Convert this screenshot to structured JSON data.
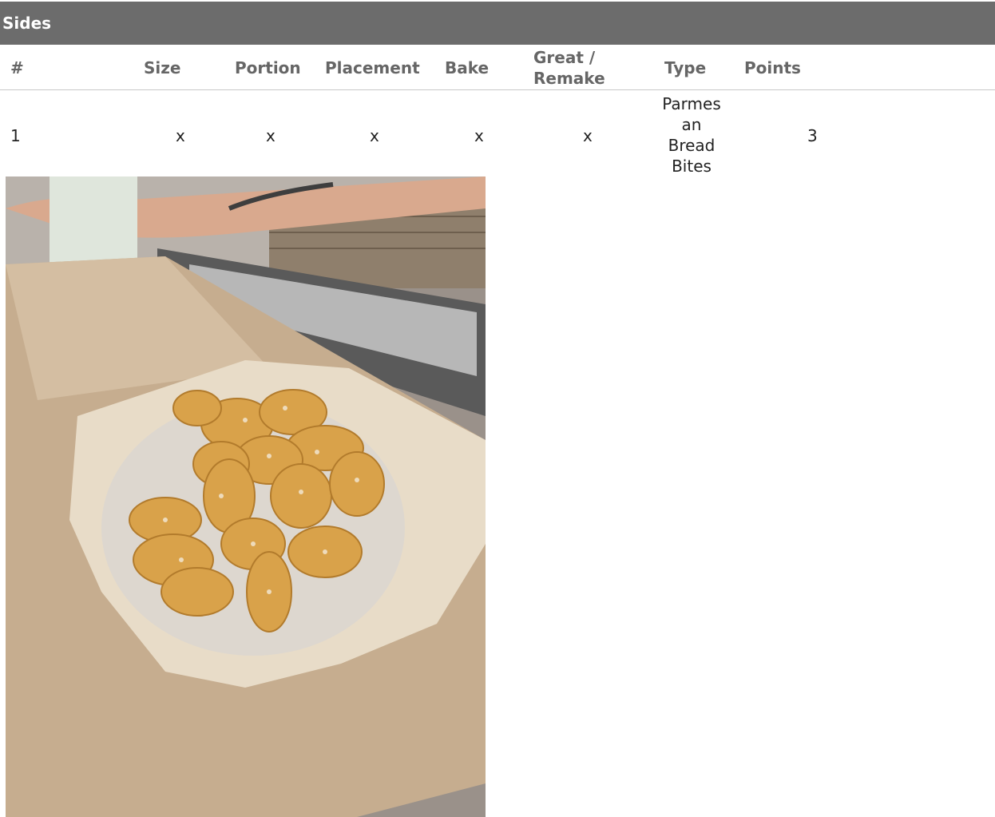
{
  "section": {
    "title": "Sides"
  },
  "table": {
    "headers": {
      "number": "#",
      "size": "Size",
      "portion": "Portion",
      "placement": "Placement",
      "bake": "Bake",
      "great_remake": "Great / Remake",
      "type": "Type",
      "points": "Points"
    },
    "rows": [
      {
        "number": "1",
        "size": "x",
        "portion": "x",
        "placement": "x",
        "bake": "x",
        "great_remake": "x",
        "type": "Parmesan Bread Bites",
        "points": "3"
      }
    ]
  },
  "photo": {
    "subject": "parmesan-bread-bites-photo"
  },
  "colors": {
    "header_bg": "#6c6c6c",
    "header_text": "#ffffff",
    "column_header_text": "#666666",
    "body_text": "#222222"
  }
}
